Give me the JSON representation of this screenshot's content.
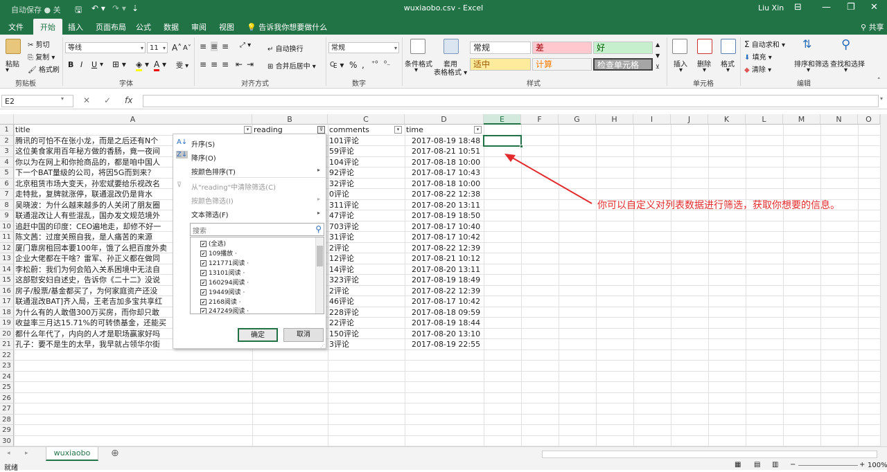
{
  "titlebar": {
    "autosave": "自动保存",
    "autosave_state": "关",
    "title": "wuxiaobo.csv  -  Excel",
    "user": "Liu Xin"
  },
  "tabs": [
    "文件",
    "开始",
    "插入",
    "页面布局",
    "公式",
    "数据",
    "审阅",
    "视图"
  ],
  "active_tab": "开始",
  "tellme": "告诉我你想要做什么",
  "share": "共享",
  "ribbon": {
    "clipboard": {
      "paste": "粘贴",
      "cut": "剪切",
      "copy": "复制",
      "format_painter": "格式刷",
      "label": "剪贴板"
    },
    "font": {
      "name": "等线",
      "size": "11",
      "bold": "B",
      "italic": "I",
      "underline": "U",
      "label": "字体",
      "grow": "A",
      "shrink": "A"
    },
    "alignment": {
      "wrap": "自动换行",
      "merge": "合并后居中",
      "label": "对齐方式"
    },
    "number": {
      "format": "常规",
      "percent": "%",
      "comma": ",",
      "label": "数字"
    },
    "styles": {
      "conditional": "条件格式",
      "table_line1": "套用",
      "table_line2": "表格格式",
      "normal": "常规",
      "bad": "差",
      "good": "好",
      "neutral": "适中",
      "calc": "计算",
      "check": "检查单元格",
      "label": "样式"
    },
    "cells": {
      "insert": "插入",
      "delete": "删除",
      "format": "格式",
      "label": "单元格"
    },
    "editing": {
      "autosum": "自动求和",
      "fill": "填充",
      "clear": "清除",
      "sort": "排序和筛选",
      "find": "查找和选择",
      "label": "编辑"
    }
  },
  "formula_bar": {
    "namebox": "E2",
    "fx": "fx",
    "content": ""
  },
  "columns": [
    "A",
    "B",
    "C",
    "D",
    "E",
    "F",
    "G",
    "H",
    "I",
    "J",
    "K",
    "L",
    "M",
    "N",
    "O"
  ],
  "selected_column": "E",
  "headers": {
    "A": "title",
    "B": "reading",
    "C": "comments",
    "D": "time"
  },
  "rows": [
    {
      "title": "腾讯的可怕不在张小龙，而是之后还有N个",
      "comments": "101评论",
      "time": "2017-08-19 18:48"
    },
    {
      "title": "这位美食家用百年秘方做的香肠，竟一夜间",
      "comments": "59评论",
      "time": "2017-08-21 10:51"
    },
    {
      "title": "你以为在网上和你抢商品的，都是咱中国人",
      "comments": "104评论",
      "time": "2017-08-18 10:00"
    },
    {
      "title": "下一个BAT量级的公司，将因5G而到来？",
      "comments": "92评论",
      "time": "2017-08-17 10:43"
    },
    {
      "title": "北京租赁市场大变天，孙宏斌要给乐视改名",
      "comments": "32评论",
      "time": "2017-08-18 10:00"
    },
    {
      "title": "走特批，复牌就涨停，联通混改仍是背水",
      "comments": "0评论",
      "time": "2017-08-22 12:38"
    },
    {
      "title": "吴晓波：为什么越来越多的人关闭了朋友圈",
      "comments": "311评论",
      "time": "2017-08-20 13:11"
    },
    {
      "title": "联通混改让人有些混乱，国办发文规范境外",
      "comments": "47评论",
      "time": "2017-08-19 18:50"
    },
    {
      "title": "追赶中国的印度：CEO遍地走，却修不好一",
      "comments": "703评论",
      "time": "2017-08-17 10:40"
    },
    {
      "title": "陈文茜：过度关照自我，是人痛苦的来源",
      "comments": "31评论",
      "time": "2017-08-17 10:42"
    },
    {
      "title": "厦门靠房租回本要100年，饿了么把百度外卖",
      "comments": "2评论",
      "time": "2017-08-22 12:39"
    },
    {
      "title": "企业大佬都在干啥？雷军、孙正义都在做同",
      "comments": "12评论",
      "time": "2017-08-21 10:12"
    },
    {
      "title": "李松蔚：我们为何会陷入关系困境中无法自",
      "comments": "14评论",
      "time": "2017-08-20 13:11"
    },
    {
      "title": "这部慰安妇自述史，告诉你《二十二》没说",
      "comments": "323评论",
      "time": "2017-08-19 18:49"
    },
    {
      "title": "房子/股票/基金都买了，为何家庭资产还没",
      "comments": "2评论",
      "time": "2017-08-22 12:39"
    },
    {
      "title": "联通混改BAT]齐入局，王老吉加多宝共享红",
      "comments": "46评论",
      "time": "2017-08-17 10:42"
    },
    {
      "title": "为什么有的人敢借300万买房，而你却只敢",
      "comments": "228评论",
      "time": "2017-08-18 09:59"
    },
    {
      "title": "收益率三月达15.71%的可转债基金，还能买",
      "comments": "22评论",
      "time": "2017-08-19 18:44"
    },
    {
      "title": "都什么年代了，内向的人才是职场赢家好吗",
      "comments": "150评论",
      "time": "2017-08-20 13:10"
    },
    {
      "title": "孔子：要不是生的太早，我早就占领华尔街",
      "comments": "3评论",
      "time": "2017-08-19 22:55"
    }
  ],
  "row_numbers": [
    "1",
    "2",
    "3",
    "4",
    "5",
    "6",
    "7",
    "8",
    "9",
    "10",
    "11",
    "12",
    "13",
    "14",
    "15",
    "16",
    "17",
    "18",
    "19",
    "20",
    "21",
    "22",
    "23",
    "24",
    "25",
    "26",
    "27",
    "28",
    "29",
    "30"
  ],
  "filter_menu": {
    "sort_asc": "升序(S)",
    "sort_desc": "降序(O)",
    "sort_color": "按颜色排序(T)",
    "clear_filter": "从\"reading\"中清除筛选(C)",
    "color_filter": "按颜色筛选(I)",
    "text_filter": "文本筛选(F)",
    "search": "搜索",
    "items": [
      "(全选)",
      "109播放 ·",
      "121771阅读 ·",
      "13101阅读 ·",
      "160294阅读 ·",
      "19449阅读 ·",
      "2168阅读 ·",
      "247249阅读 ·"
    ],
    "ok": "确定",
    "cancel": "取消"
  },
  "annotation": "你可以自定义对列表数据进行筛选，获取你想要的信息。",
  "sheet_tab": "wuxiaobo",
  "status": {
    "ready": "就绪",
    "zoom": "100%"
  },
  "colors": {
    "excel_green": "#217346",
    "annotation_red": "#e32b2b"
  }
}
